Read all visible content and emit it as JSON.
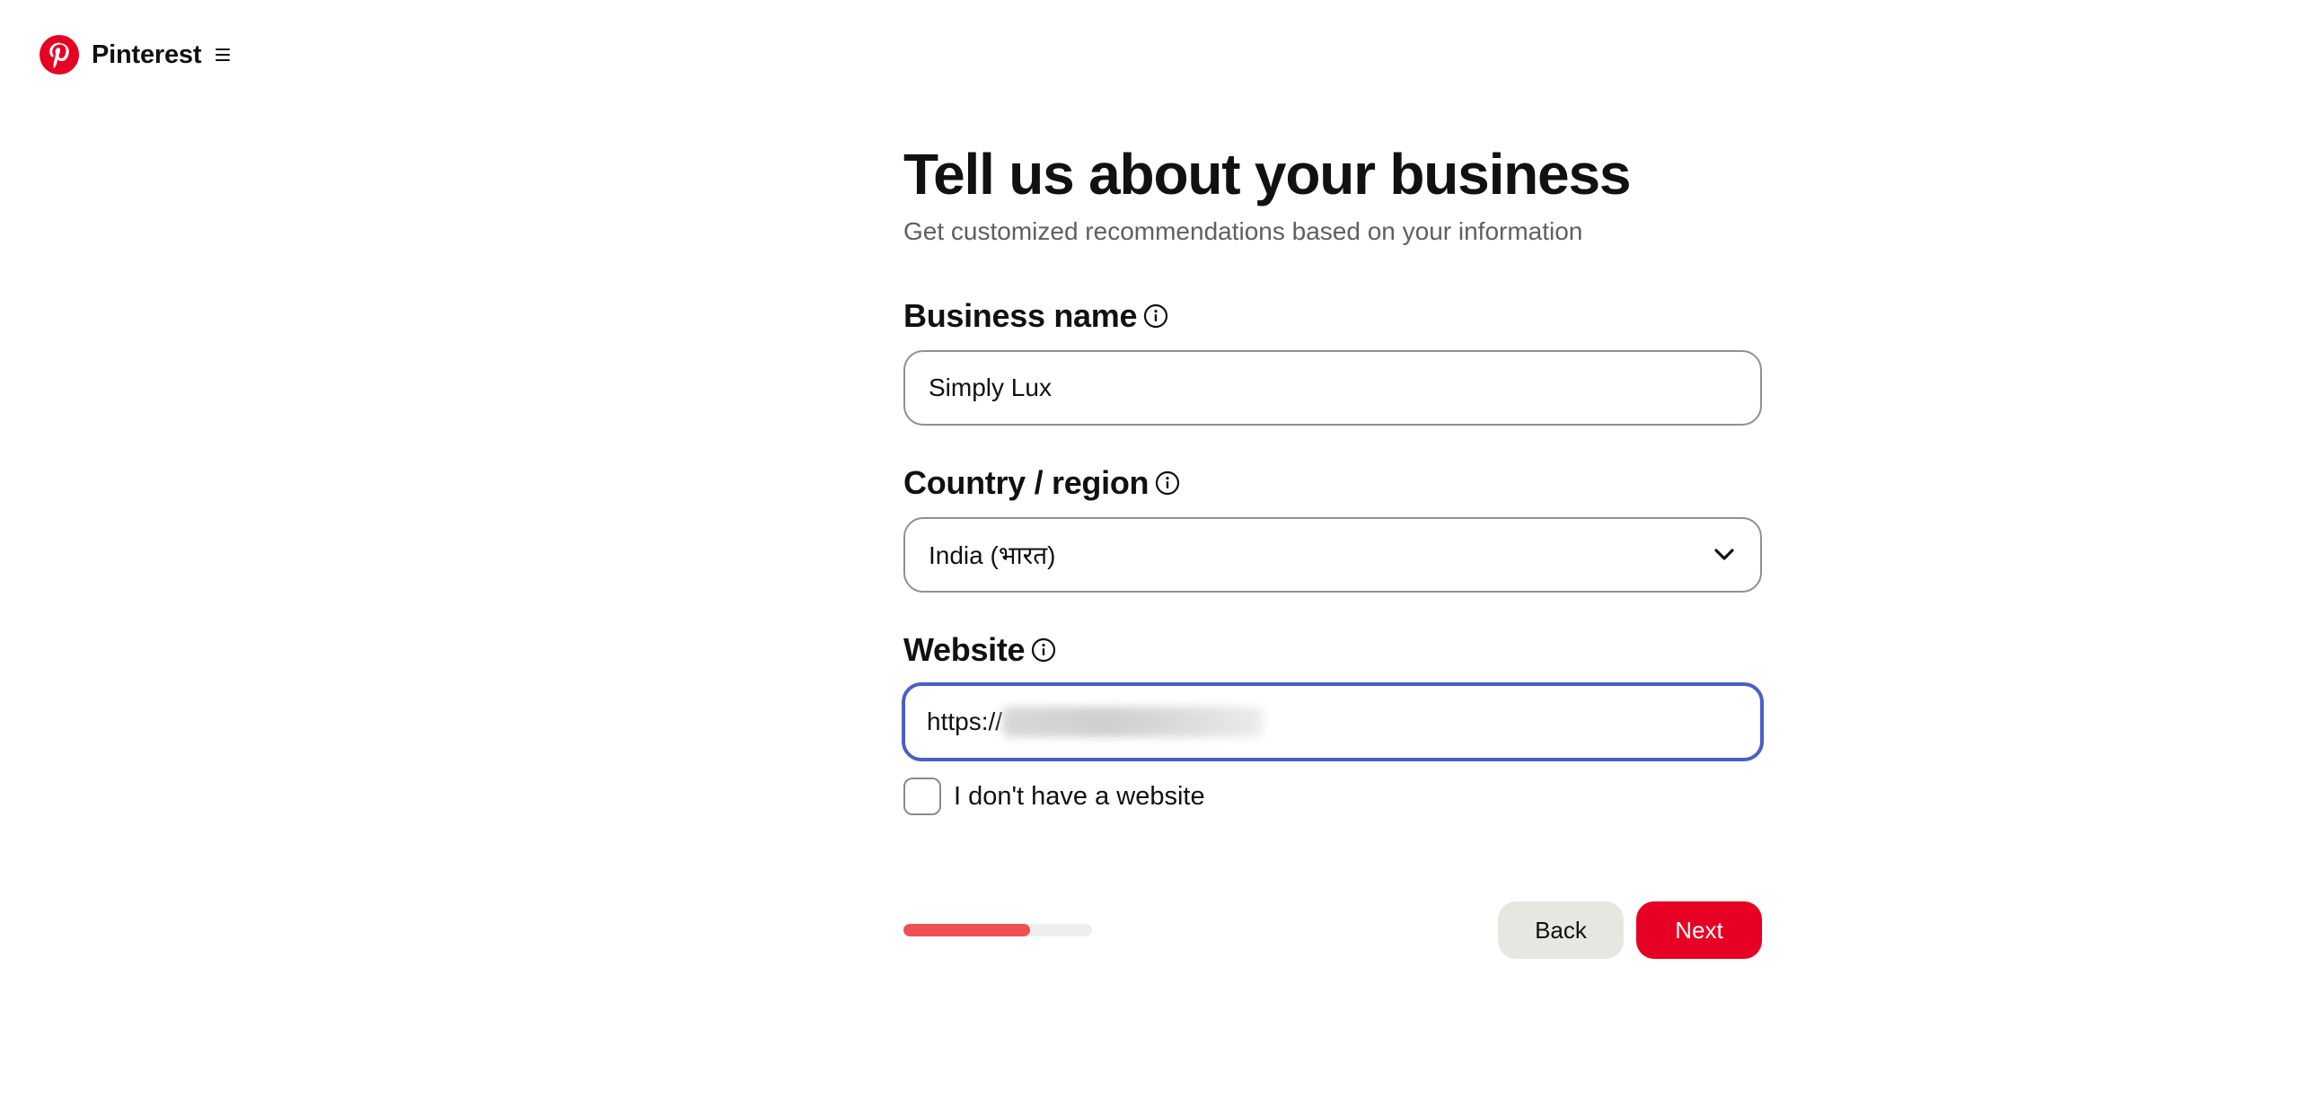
{
  "header": {
    "brand": "Pinterest",
    "brand_color": "#e60023",
    "logo_icon": "pinterest-logo-icon",
    "menu_icon": "hamburger-menu-icon"
  },
  "main": {
    "title": "Tell us about your business",
    "subtitle": "Get customized recommendations based on your information"
  },
  "fields": {
    "business_name": {
      "label": "Business name",
      "value": "Simply Lux",
      "info_icon": "info-icon"
    },
    "country": {
      "label": "Country / region",
      "selected": "India (भारत)",
      "info_icon": "info-icon",
      "chevron_icon": "chevron-down-icon"
    },
    "website": {
      "label": "Website",
      "value_prefix": "https://",
      "value_obscured": true,
      "info_icon": "info-icon",
      "focus_color": "#4b5fc7"
    },
    "no_website": {
      "label": "I don't have a website",
      "checked": false
    }
  },
  "footer": {
    "progress_fraction": 0.67,
    "progress_color": "#ef4f53",
    "back_label": "Back",
    "next_label": "Next",
    "next_color": "#e60023"
  }
}
